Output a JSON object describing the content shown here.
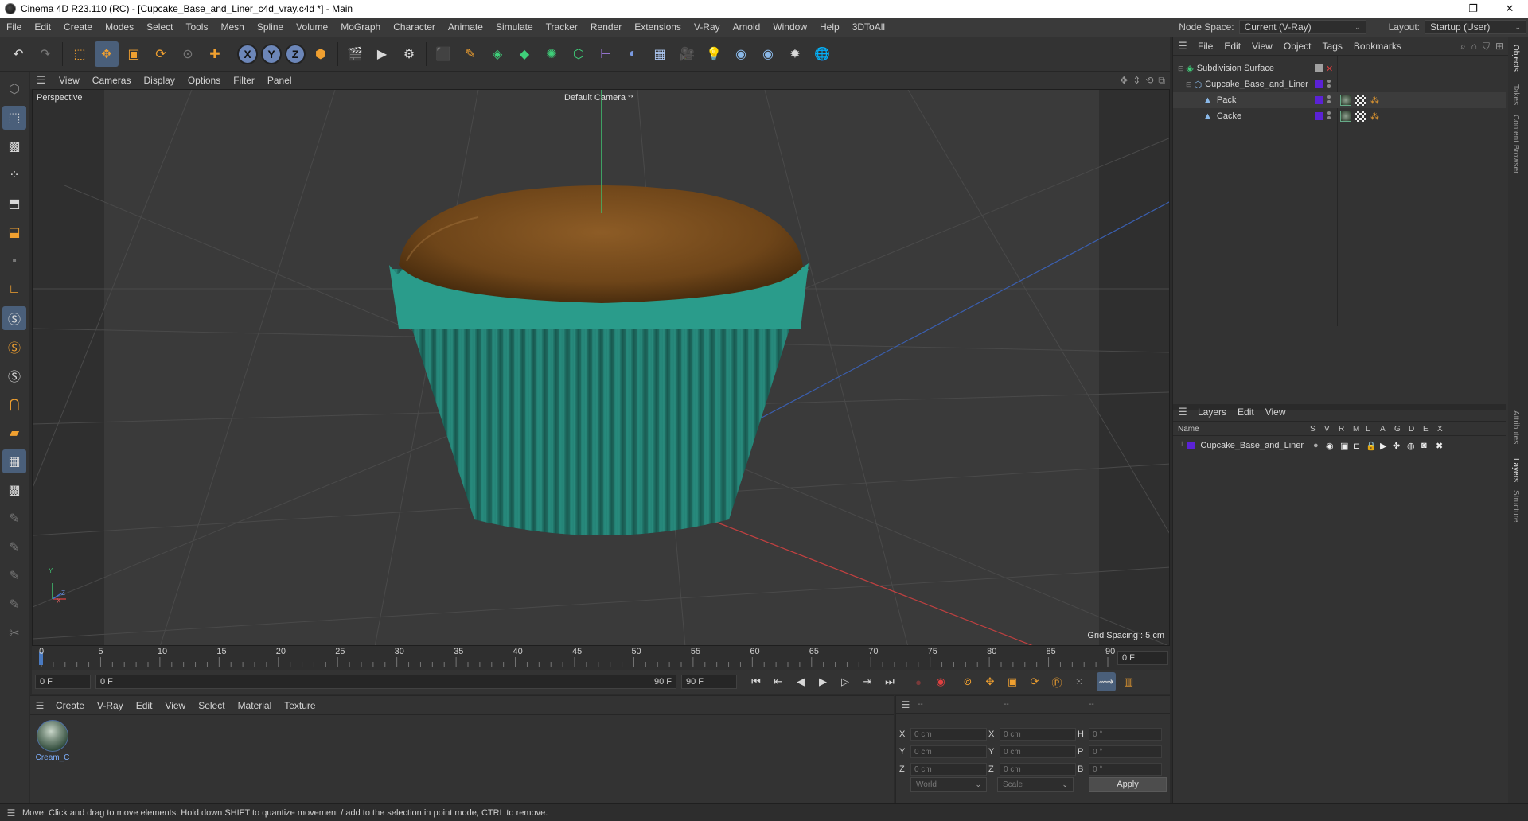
{
  "titlebar": {
    "title": "Cinema 4D R23.110 (RC) - [Cupcake_Base_and_Liner_c4d_vray.c4d *] - Main",
    "minimize": "—",
    "maximize": "❐",
    "close": "✕"
  },
  "menubar": {
    "items": [
      "File",
      "Edit",
      "Create",
      "Modes",
      "Select",
      "Tools",
      "Mesh",
      "Spline",
      "Volume",
      "MoGraph",
      "Character",
      "Animate",
      "Simulate",
      "Tracker",
      "Render",
      "Extensions",
      "V-Ray",
      "Arnold",
      "Window",
      "Help",
      "3DToAll"
    ],
    "node_space_label": "Node Space:",
    "node_space_value": "Current (V-Ray)",
    "layout_label": "Layout:",
    "layout_value": "Startup (User)"
  },
  "viewport": {
    "menu": [
      "View",
      "Cameras",
      "Display",
      "Options",
      "Filter",
      "Panel"
    ],
    "perspective_label": "Perspective",
    "camera_label": "Default Camera",
    "camera_glyph": "°*",
    "grid_spacing": "Grid Spacing : 5 cm",
    "axis_y": "Y",
    "axis_z": "Z",
    "axis_x": "X"
  },
  "timeline": {
    "ticks": [
      "0",
      "5",
      "10",
      "15",
      "20",
      "25",
      "30",
      "35",
      "40",
      "45",
      "50",
      "55",
      "60",
      "65",
      "70",
      "75",
      "80",
      "85",
      "90"
    ],
    "current_frame": "0 F"
  },
  "playbar": {
    "start_field": "0 F",
    "range_start": "0 F",
    "range_end": "90 F",
    "end_field": "90 F"
  },
  "material_manager": {
    "menu": [
      "Create",
      "V-Ray",
      "Edit",
      "View",
      "Select",
      "Material",
      "Texture"
    ],
    "materials": [
      {
        "name": "Cream_C"
      }
    ]
  },
  "coordinates": {
    "header": [
      "--",
      "--",
      "--"
    ],
    "rows": [
      {
        "a": "X",
        "av": "0 cm",
        "b": "X",
        "bv": "0 cm",
        "c": "H",
        "cv": "0 °"
      },
      {
        "a": "Y",
        "av": "0 cm",
        "b": "Y",
        "bv": "0 cm",
        "c": "P",
        "cv": "0 °"
      },
      {
        "a": "Z",
        "av": "0 cm",
        "b": "Z",
        "bv": "0 cm",
        "c": "B",
        "cv": "0 °"
      }
    ],
    "world": "World",
    "scale": "Scale",
    "apply": "Apply"
  },
  "status": {
    "text": "Move: Click and drag to move elements. Hold down SHIFT to quantize movement / add to the selection in point mode, CTRL to remove."
  },
  "object_manager": {
    "menu": [
      "File",
      "Edit",
      "View",
      "Object",
      "Tags",
      "Bookmarks"
    ],
    "objects": [
      {
        "name": "Subdivision Surface",
        "indent": 0
      },
      {
        "name": "Cupcake_Base_and_Liner",
        "indent": 1
      },
      {
        "name": "Pack",
        "indent": 2
      },
      {
        "name": "Cacke",
        "indent": 2
      }
    ]
  },
  "layer_manager": {
    "menu": [
      "Layers",
      "Edit",
      "View"
    ],
    "columns": [
      "Name",
      "S",
      "V",
      "R",
      "M",
      "L",
      "A",
      "G",
      "D",
      "E",
      "X"
    ],
    "layers": [
      {
        "name": "Cupcake_Base_and_Liner"
      }
    ]
  },
  "side_tabs": [
    "Objects",
    "Takes",
    "Content Browser",
    "Attributes",
    "Layers",
    "Structure"
  ],
  "colors": {
    "layer": "#5b22d6",
    "liner": "#2a9a8a",
    "cake": "#8a5a24",
    "accent": "#4a5f7a"
  }
}
